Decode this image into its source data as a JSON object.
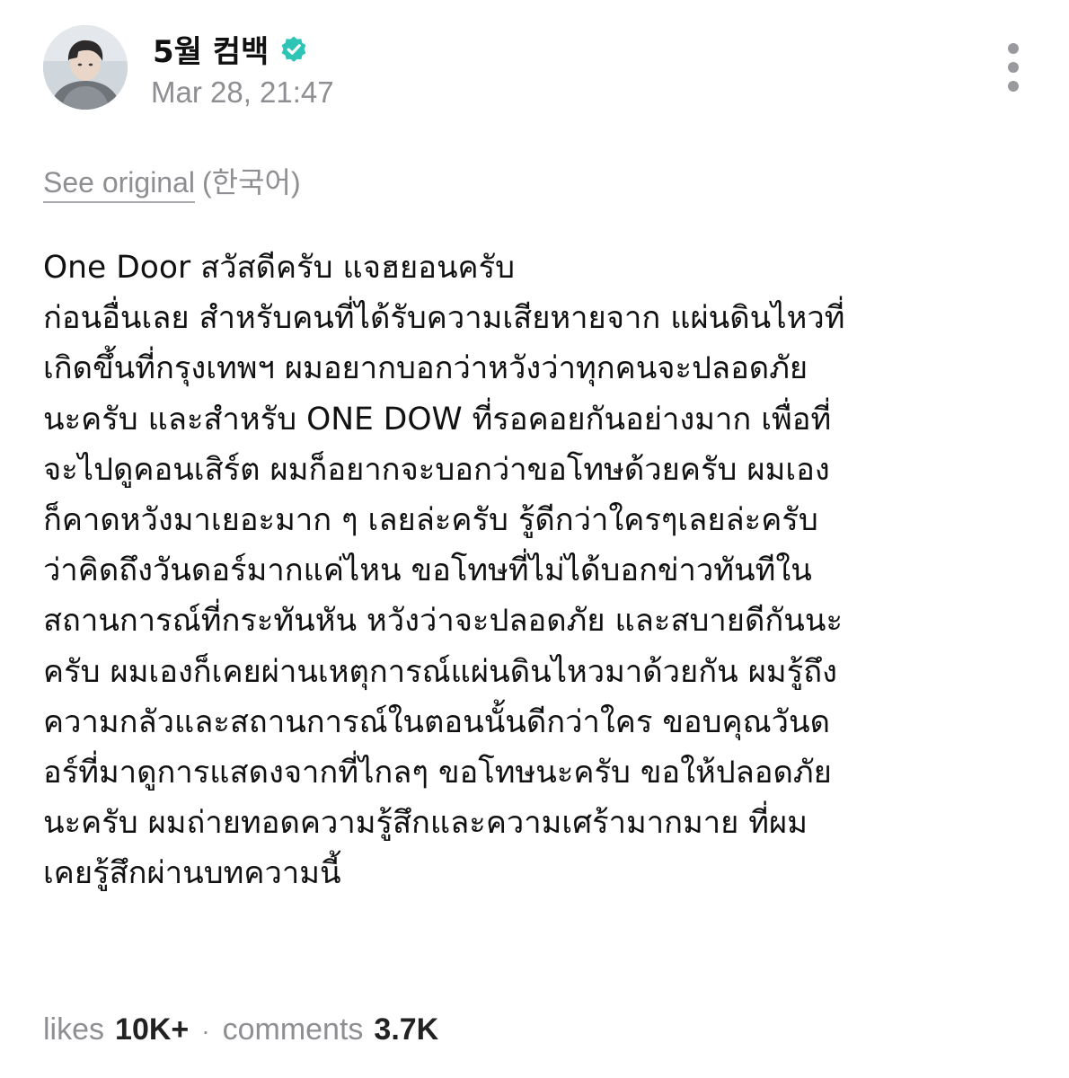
{
  "post": {
    "author": "5월 컴백",
    "verified_icon": "verified-badge-icon",
    "timestamp": "Mar 28, 21:47",
    "see_original": "See original",
    "original_language": "(한국어)",
    "body_lines": [
      "One Door สวัสดีครับ แจฮยอนครับ",
      "ก่อนอื่นเลย สำหรับคนที่ได้รับความเสียหายจาก แผ่นดินไหวที่",
      "เกิดขึ้นที่กรุงเทพฯ ผมอยากบอกว่าหวังว่าทุกคนจะปลอดภัย",
      "นะครับ และสำหรับ ONE DOW ที่รอคอยกันอย่างมาก เพื่อที่",
      "จะไปดูคอนเสิร์ต ผมก็อยากจะบอกว่าขอโทษด้วยครับ ผมเอง",
      "ก็คาดหวังมาเยอะมาก ๆ เลยล่ะครับ รู้ดีกว่าใครๆเลยล่ะครับ",
      "ว่าคิดถึงวันดอร์มากแค่ไหน ขอโทษที่ไม่ได้บอกข่าวทันทีใน",
      "สถานการณ์ที่กระทันหัน หวังว่าจะปลอดภัย และสบายดีกันนะ",
      "ครับ ผมเองก็เคยผ่านเหตุการณ์แผ่นดินไหวมาด้วยกัน ผมรู้ถึง",
      "ความกลัวและสถานการณ์ในตอนนั้นดีกว่าใคร ขอบคุณวันด",
      "อร์ที่มาดูการแสดงจากที่ไกลๆ ขอโทษนะครับ ขอให้ปลอดภัย",
      "นะครับ ผมถ่ายทอดความรู้สึกและความเศร้ามากมาย ที่ผม",
      "เคยรู้สึกผ่านบทความนี้"
    ]
  },
  "stats": {
    "likes_label": "likes",
    "likes_value": "10K+",
    "separator": "·",
    "comments_label": "comments",
    "comments_value": "3.7K"
  },
  "colors": {
    "verified": "#2ec4b6",
    "muted_text": "#8e8e93",
    "body_text": "#111111"
  },
  "icons": {
    "more_menu": "more-vertical-icon",
    "avatar": "avatar-photo"
  }
}
